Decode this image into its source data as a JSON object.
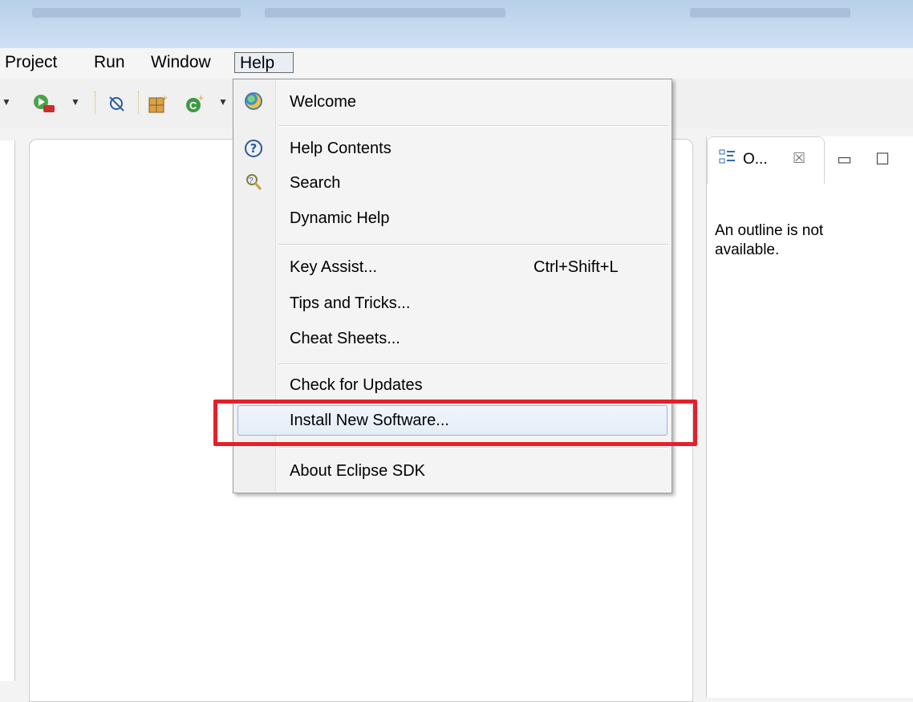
{
  "menubar": {
    "items": [
      {
        "label": "Project"
      },
      {
        "label": "Run"
      },
      {
        "label": "Window"
      },
      {
        "label": "Help",
        "active": true
      }
    ]
  },
  "toolbar": {
    "icons": [
      "run-dropdown-icon",
      "debug-icon",
      "toggle-breakpoint-icon",
      "new-package-icon",
      "new-class-icon"
    ]
  },
  "help_menu": {
    "items": [
      {
        "label": "Welcome",
        "icon": "welcome-icon"
      },
      {
        "label": "Help Contents",
        "icon": "help-icon"
      },
      {
        "label": "Search",
        "icon": "search-help-icon"
      },
      {
        "label": "Dynamic Help"
      },
      {
        "label": "Key Assist...",
        "shortcut": "Ctrl+Shift+L"
      },
      {
        "label": "Tips and Tricks..."
      },
      {
        "label": "Cheat Sheets..."
      },
      {
        "label": "Check for Updates"
      },
      {
        "label": "Install New Software...",
        "highlighted": true
      },
      {
        "label": "About Eclipse SDK"
      }
    ]
  },
  "outline": {
    "tab_label": "O...",
    "close_glyph": "☒",
    "minimize_glyph": "▭",
    "maximize_glyph": "☐",
    "message": "An outline is not available."
  },
  "colors": {
    "highlight_border": "#e5202a",
    "titlebar": "#c6dbf1"
  }
}
